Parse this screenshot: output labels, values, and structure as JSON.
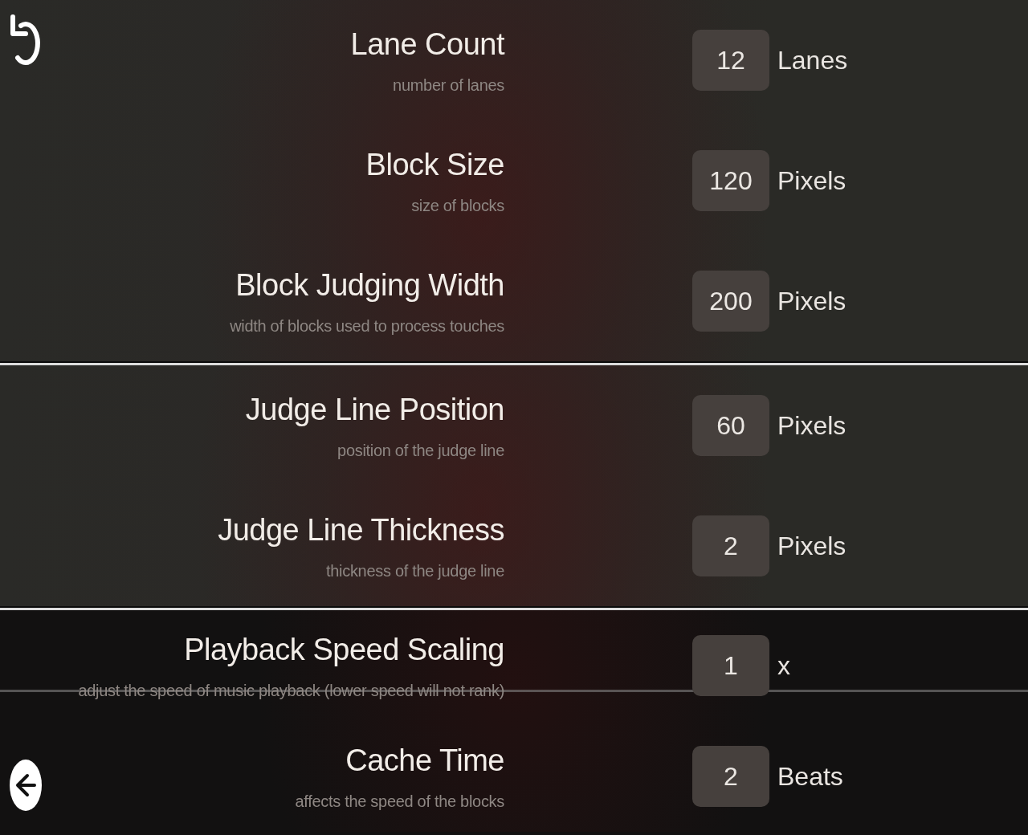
{
  "sections": [
    {
      "settings": [
        {
          "label": "Lane Count",
          "description": "number of lanes",
          "value": "12",
          "unit": "Lanes"
        },
        {
          "label": "Block Size",
          "description": "size of blocks",
          "value": "120",
          "unit": "Pixels"
        },
        {
          "label": "Block Judging Width",
          "description": "width of blocks used to process touches",
          "value": "200",
          "unit": "Pixels"
        }
      ]
    },
    {
      "settings": [
        {
          "label": "Judge Line Position",
          "description": "position of the judge line",
          "value": "60",
          "unit": "Pixels"
        },
        {
          "label": "Judge Line Thickness",
          "description": "thickness of the judge line",
          "value": "2",
          "unit": "Pixels"
        }
      ]
    },
    {
      "settings": [
        {
          "label": "Playback Speed Scaling",
          "description": "adjust the speed of music playback (lower speed will not rank)",
          "value": "1",
          "unit": "x"
        },
        {
          "label": "Cache Time",
          "description": "affects the speed of the blocks",
          "value": "2",
          "unit": "Beats"
        }
      ]
    }
  ]
}
